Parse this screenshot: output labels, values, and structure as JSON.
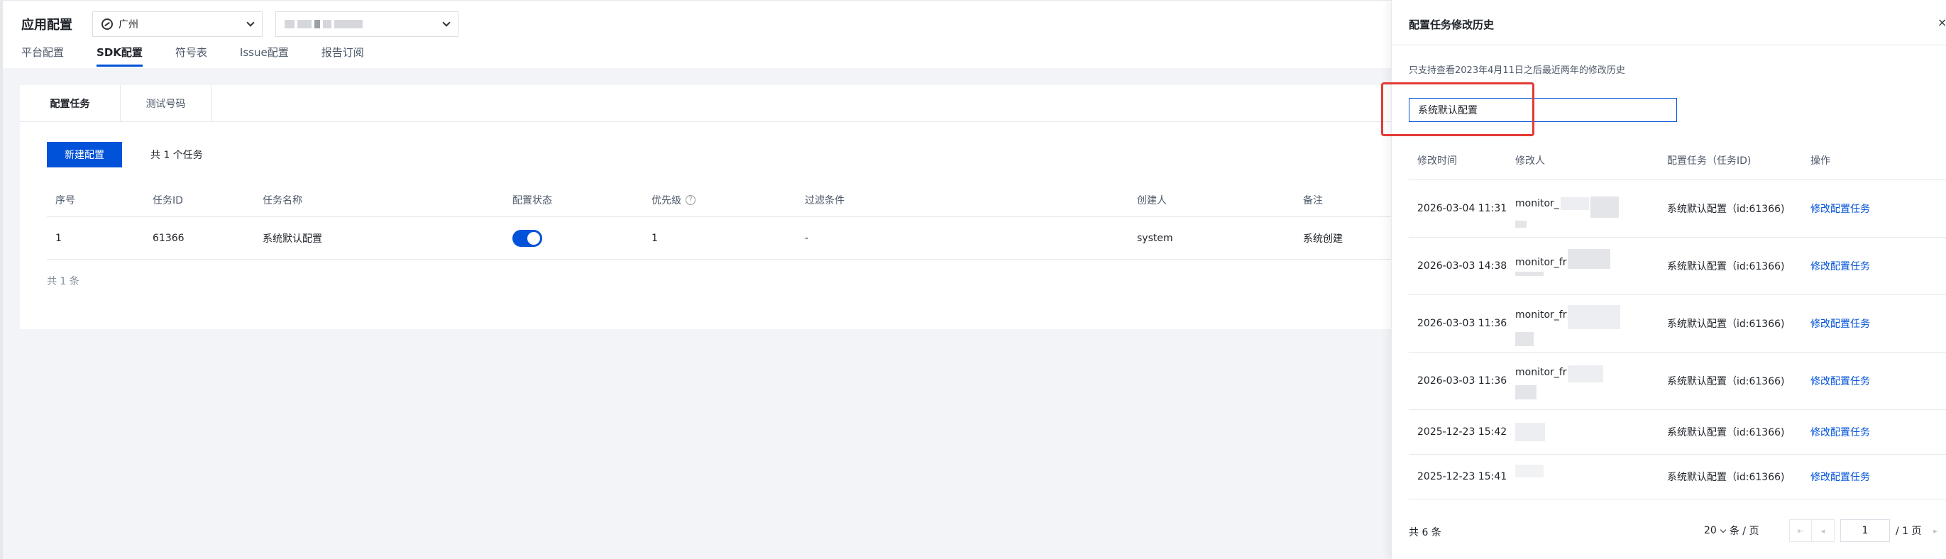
{
  "header": {
    "app_title": "应用配置",
    "region": "广州",
    "app_name": "",
    "nav_tabs": [
      "平台配置",
      "SDK配置",
      "符号表",
      "Issue配置",
      "报告订阅"
    ],
    "active_tab": "SDK配置"
  },
  "main": {
    "sub_tabs": [
      "配置任务",
      "测试号码"
    ],
    "new_button": "新建配置",
    "task_count": "共 1 个任务",
    "columns": [
      "序号",
      "任务ID",
      "任务名称",
      "配置状态",
      "优先级",
      "过滤条件",
      "创建人",
      "备注"
    ],
    "help_icon": "?",
    "rows": [
      {
        "index": "1",
        "task_id": "61366",
        "task_name": "系统默认配置",
        "enabled": true,
        "priority": "1",
        "filter": "-",
        "creator": "system",
        "note": "系统创建"
      }
    ],
    "footer": "共 1 条"
  },
  "drawer": {
    "title": "配置任务修改历史",
    "close": "×",
    "note": "只支持查看2023年4月11日之后最近两年的修改历史",
    "search_value": "系统默认配置",
    "columns": [
      "修改时间",
      "修改人",
      "配置任务（任务ID)",
      "操作"
    ],
    "rows": [
      {
        "time": "2026-03-04 11:31",
        "user": "monitor_",
        "task": "系统默认配置（id:61366)",
        "action": "修改配置任务"
      },
      {
        "time": "2026-03-03 14:38",
        "user": "monitor_fr",
        "task": "系统默认配置（id:61366)",
        "action": "修改配置任务"
      },
      {
        "time": "2026-03-03 11:36",
        "user": "monitor_fr",
        "task": "系统默认配置（id:61366)",
        "action": "修改配置任务"
      },
      {
        "time": "2026-03-03 11:36",
        "user": "monitor_fr",
        "task": "系统默认配置（id:61366)",
        "action": "修改配置任务"
      },
      {
        "time": "2025-12-23 15:42",
        "user": "",
        "task": "系统默认配置（id:61366)",
        "action": "修改配置任务"
      },
      {
        "time": "2025-12-23 15:41",
        "user": "",
        "task": "系统默认配置（id:61366)",
        "action": "修改配置任务"
      }
    ],
    "total": "共 6 条",
    "page_size": "20",
    "page_size_unit": "条 / 页",
    "current_page": "1",
    "total_pages": "/ 1 页",
    "pager_icons": {
      "first": "⇤",
      "prev": "◂",
      "next": "▸"
    }
  },
  "colors": {
    "primary": "#0052d9",
    "highlight": "#e53935"
  }
}
